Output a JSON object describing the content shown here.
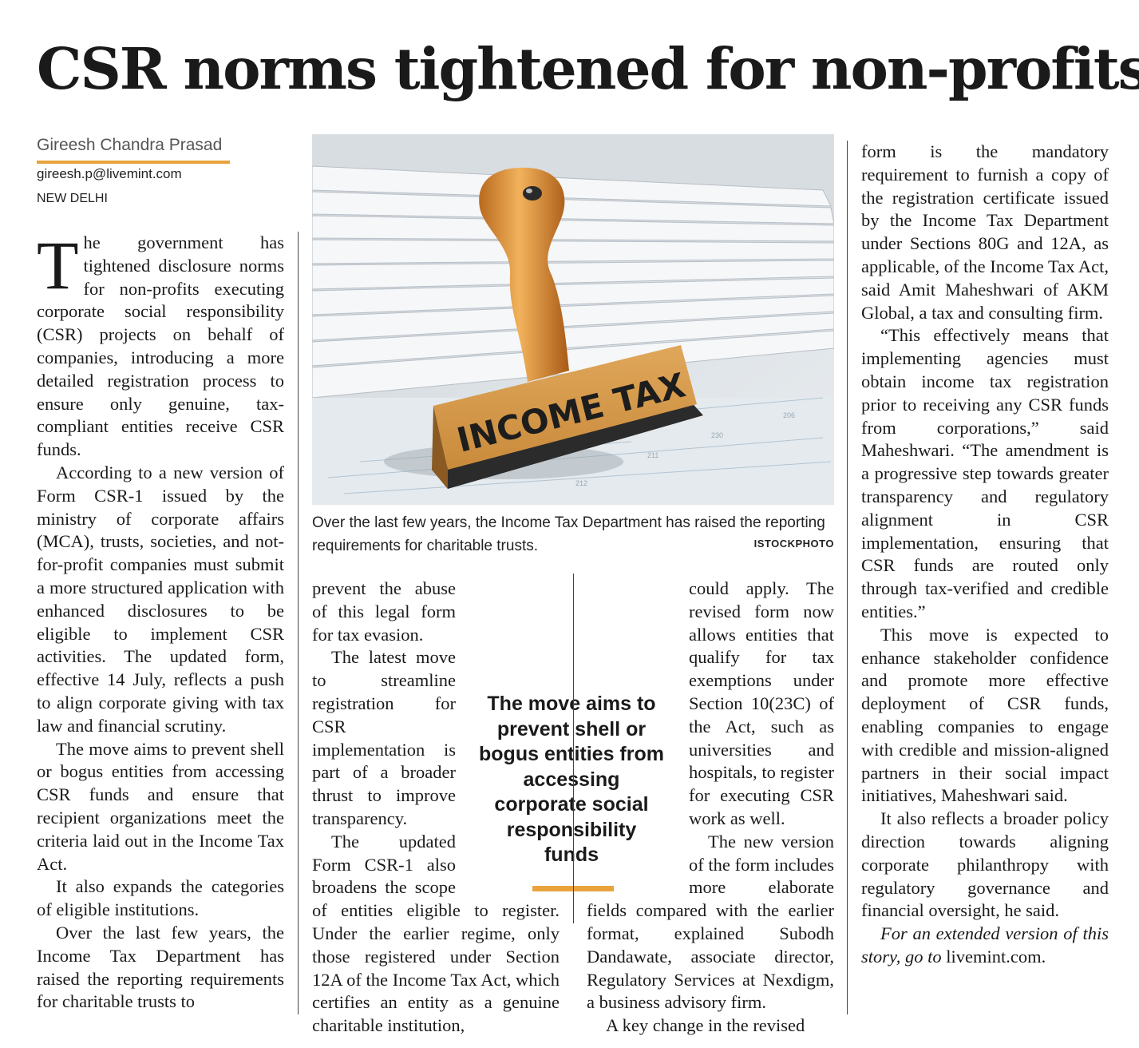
{
  "headline": "CSR norms tightened for non-profits",
  "byline": {
    "author": "Gireesh Chandra Prasad",
    "email": "gireesh.p@livemint.com",
    "dateline": "NEW DELHI"
  },
  "photo": {
    "stamp_text": "INCOME TAX",
    "caption": "Over the last few years, the Income Tax Department has raised the reporting requirements for charitable trusts.",
    "credit": "ISTOCKPHOTO"
  },
  "pull_quote": "The move aims to prevent shell or bogus entities from accessing corporate social responsibility funds",
  "colors": {
    "accent": "#e8a33d",
    "text": "#1a1a1a"
  },
  "article": {
    "dropcap": "T",
    "p1_rest": "he government has tightened disclosure norms for non-profits executing corporate social responsibility (CSR) projects on behalf of companies, introducing a more detailed registration process to ensure only genuine, tax-compliant entities receive CSR funds.",
    "p2": "According to a new version of Form CSR-1 issued by the ministry of corporate affairs (MCA), trusts, societies, and not-for-profit companies must submit a more structured application with enhanced disclosures to be eligible to implement CSR activities. The updated form, effective 14 July, reflects a push to align corporate giving with tax law and financial scrutiny.",
    "p3": "The move aims to prevent shell or bogus entities from accessing CSR funds and ensure that recipient organizations meet the criteria laid out in the Income Tax Act.",
    "p4": "It also expands the categories of eligible institutions.",
    "p5_start": "Over the last few years, the Income Tax Department has raised the reporting requirements for charitable trusts to",
    "p5_cont": "prevent the abuse of this legal form for tax evasion.",
    "p6": "The latest move to streamline registration for CSR implementation is part of a broader thrust to improve transparency.",
    "p7_start": "The updated Form CSR-1 also broadens the scope of entities eligible to register. Under the earlier regime, only those registered under Section 12A of the Income Tax Act, which certifies an entity as a genuine charitable institution,",
    "p7_cont": "could apply. The revised form now allows entities that qualify for tax exemptions under Section 10(23C) of the Act, such as universities and hospitals, to register for executing CSR work as well.",
    "p8": "The new version of the form includes more elaborate fields compared with the earlier format, explained Subodh Dandawate, associate director, Regulatory Services at Nexdigm, a business advisory firm.",
    "p9_start": "A key change in the revised",
    "p9_cont": "form is the mandatory requirement to furnish a copy of the registration certificate issued by the Income Tax Department under Sections 80G and 12A, as applicable, of the Income Tax Act, said Amit Maheshwari of AKM Global, a tax and consulting firm.",
    "p10": "“This effectively means that implementing agencies must obtain income tax registration prior to receiving any CSR funds from corporations,” said Maheshwari. “The amendment is a progressive step towards greater transparency and regulatory alignment in CSR implementation, ensuring that CSR funds are routed only through tax-verified and credible entities.”",
    "p11": "This move is expected to enhance stakeholder confidence and promote more effective deployment of CSR funds, enabling companies to engage with credible and mission-aligned partners in their social impact initiatives, Maheshwari said.",
    "p12": "It also reflects a broader policy direction towards aligning corporate philanthropy with regulatory governance and financial oversight, he said.",
    "tail_italic": "For an extended version of this story, go to",
    "tail_site": "livemint.com."
  }
}
